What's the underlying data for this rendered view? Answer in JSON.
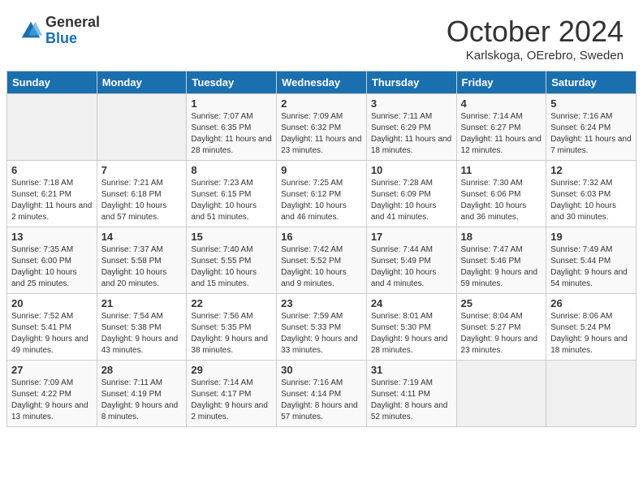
{
  "header": {
    "logo_general": "General",
    "logo_blue": "Blue",
    "month": "October 2024",
    "location": "Karlskoga, OErebro, Sweden"
  },
  "weekdays": [
    "Sunday",
    "Monday",
    "Tuesday",
    "Wednesday",
    "Thursday",
    "Friday",
    "Saturday"
  ],
  "weeks": [
    [
      {
        "day": "",
        "empty": true
      },
      {
        "day": "",
        "empty": true
      },
      {
        "day": "1",
        "sunrise": "7:07 AM",
        "sunset": "6:35 PM",
        "daylight": "11 hours and 28 minutes."
      },
      {
        "day": "2",
        "sunrise": "7:09 AM",
        "sunset": "6:32 PM",
        "daylight": "11 hours and 23 minutes."
      },
      {
        "day": "3",
        "sunrise": "7:11 AM",
        "sunset": "6:29 PM",
        "daylight": "11 hours and 18 minutes."
      },
      {
        "day": "4",
        "sunrise": "7:14 AM",
        "sunset": "6:27 PM",
        "daylight": "11 hours and 12 minutes."
      },
      {
        "day": "5",
        "sunrise": "7:16 AM",
        "sunset": "6:24 PM",
        "daylight": "11 hours and 7 minutes."
      }
    ],
    [
      {
        "day": "6",
        "sunrise": "7:18 AM",
        "sunset": "6:21 PM",
        "daylight": "11 hours and 2 minutes."
      },
      {
        "day": "7",
        "sunrise": "7:21 AM",
        "sunset": "6:18 PM",
        "daylight": "10 hours and 57 minutes."
      },
      {
        "day": "8",
        "sunrise": "7:23 AM",
        "sunset": "6:15 PM",
        "daylight": "10 hours and 51 minutes."
      },
      {
        "day": "9",
        "sunrise": "7:25 AM",
        "sunset": "6:12 PM",
        "daylight": "10 hours and 46 minutes."
      },
      {
        "day": "10",
        "sunrise": "7:28 AM",
        "sunset": "6:09 PM",
        "daylight": "10 hours and 41 minutes."
      },
      {
        "day": "11",
        "sunrise": "7:30 AM",
        "sunset": "6:06 PM",
        "daylight": "10 hours and 36 minutes."
      },
      {
        "day": "12",
        "sunrise": "7:32 AM",
        "sunset": "6:03 PM",
        "daylight": "10 hours and 30 minutes."
      }
    ],
    [
      {
        "day": "13",
        "sunrise": "7:35 AM",
        "sunset": "6:00 PM",
        "daylight": "10 hours and 25 minutes."
      },
      {
        "day": "14",
        "sunrise": "7:37 AM",
        "sunset": "5:58 PM",
        "daylight": "10 hours and 20 minutes."
      },
      {
        "day": "15",
        "sunrise": "7:40 AM",
        "sunset": "5:55 PM",
        "daylight": "10 hours and 15 minutes."
      },
      {
        "day": "16",
        "sunrise": "7:42 AM",
        "sunset": "5:52 PM",
        "daylight": "10 hours and 9 minutes."
      },
      {
        "day": "17",
        "sunrise": "7:44 AM",
        "sunset": "5:49 PM",
        "daylight": "10 hours and 4 minutes."
      },
      {
        "day": "18",
        "sunrise": "7:47 AM",
        "sunset": "5:46 PM",
        "daylight": "9 hours and 59 minutes."
      },
      {
        "day": "19",
        "sunrise": "7:49 AM",
        "sunset": "5:44 PM",
        "daylight": "9 hours and 54 minutes."
      }
    ],
    [
      {
        "day": "20",
        "sunrise": "7:52 AM",
        "sunset": "5:41 PM",
        "daylight": "9 hours and 49 minutes."
      },
      {
        "day": "21",
        "sunrise": "7:54 AM",
        "sunset": "5:38 PM",
        "daylight": "9 hours and 43 minutes."
      },
      {
        "day": "22",
        "sunrise": "7:56 AM",
        "sunset": "5:35 PM",
        "daylight": "9 hours and 38 minutes."
      },
      {
        "day": "23",
        "sunrise": "7:59 AM",
        "sunset": "5:33 PM",
        "daylight": "9 hours and 33 minutes."
      },
      {
        "day": "24",
        "sunrise": "8:01 AM",
        "sunset": "5:30 PM",
        "daylight": "9 hours and 28 minutes."
      },
      {
        "day": "25",
        "sunrise": "8:04 AM",
        "sunset": "5:27 PM",
        "daylight": "9 hours and 23 minutes."
      },
      {
        "day": "26",
        "sunrise": "8:06 AM",
        "sunset": "5:24 PM",
        "daylight": "9 hours and 18 minutes."
      }
    ],
    [
      {
        "day": "27",
        "sunrise": "7:09 AM",
        "sunset": "4:22 PM",
        "daylight": "9 hours and 13 minutes."
      },
      {
        "day": "28",
        "sunrise": "7:11 AM",
        "sunset": "4:19 PM",
        "daylight": "9 hours and 8 minutes."
      },
      {
        "day": "29",
        "sunrise": "7:14 AM",
        "sunset": "4:17 PM",
        "daylight": "9 hours and 2 minutes."
      },
      {
        "day": "30",
        "sunrise": "7:16 AM",
        "sunset": "4:14 PM",
        "daylight": "8 hours and 57 minutes."
      },
      {
        "day": "31",
        "sunrise": "7:19 AM",
        "sunset": "4:11 PM",
        "daylight": "8 hours and 52 minutes."
      },
      {
        "day": "",
        "empty": true
      },
      {
        "day": "",
        "empty": true
      }
    ]
  ]
}
